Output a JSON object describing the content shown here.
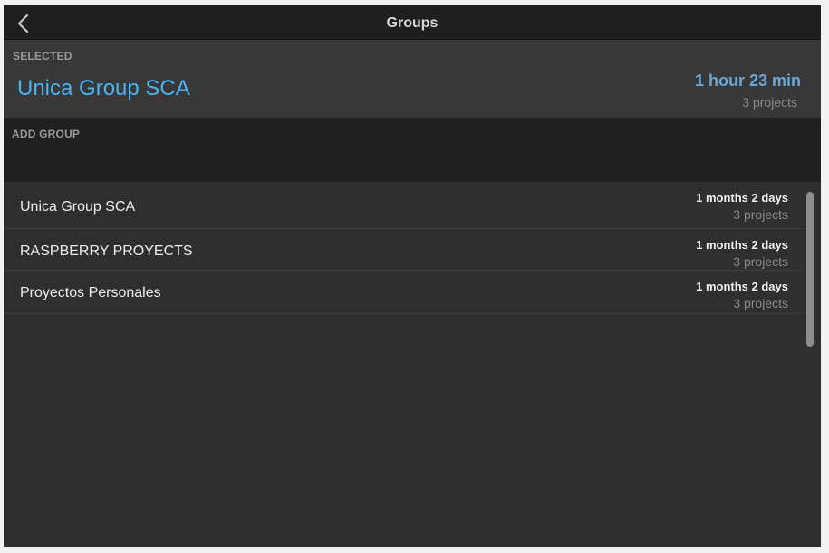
{
  "header": {
    "title": "Groups",
    "back_icon": "chevron-left-icon"
  },
  "selected": {
    "label": "SELECTED",
    "name": "Unica Group SCA",
    "time": "1 hour 23 min",
    "projects": "3 projects"
  },
  "add_group": {
    "label": "ADD GROUP",
    "value": "",
    "placeholder": ""
  },
  "groups": [
    {
      "name": "Unica Group SCA",
      "time": "1 months 2 days",
      "projects": "3 projects"
    },
    {
      "name": "RASPBERRY PROYECTS",
      "time": "1 months 2 days",
      "projects": "3 projects"
    },
    {
      "name": "Proyectos Personales",
      "time": "1 months 2 days",
      "projects": "3 projects"
    }
  ],
  "colors": {
    "accent": "#4ab3f0",
    "selected_time": "#6aa6d6",
    "background": "#2f2f2f",
    "titlebar": "#1f1f1f"
  }
}
